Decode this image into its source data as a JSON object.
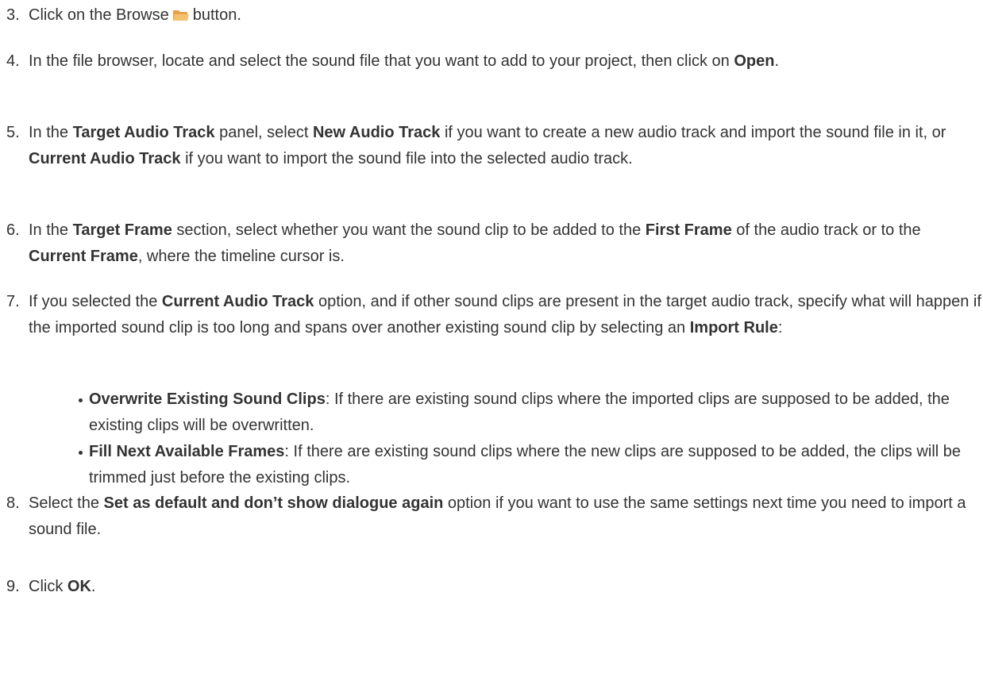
{
  "steps": [
    {
      "num": "3.",
      "parts": [
        {
          "t": "Click on the Browse"
        },
        {
          "icon": "folder-icon"
        },
        {
          "t": "button."
        }
      ]
    },
    {
      "num": "4.",
      "parts": [
        {
          "t": "In the file browser, locate and select the sound file that you want to add to your project, then click on "
        },
        {
          "b": "Open"
        },
        {
          "t": "."
        }
      ]
    },
    {
      "num": "5.",
      "parts": [
        {
          "t": "In the "
        },
        {
          "b": "Target Audio Track"
        },
        {
          "t": " panel, select "
        },
        {
          "b": "New Audio Track"
        },
        {
          "t": " if you want to create a new audio track and import the sound file in it, or "
        },
        {
          "b": "Current Audio Track"
        },
        {
          "t": " if you want to import the sound file into the selected audio track."
        }
      ]
    },
    {
      "num": "6.",
      "parts": [
        {
          "t": "In the "
        },
        {
          "b": "Target Frame"
        },
        {
          "t": " section, select whether you want the sound clip to be added to the "
        },
        {
          "b": "First Frame"
        },
        {
          "t": " of the audio track or to the "
        },
        {
          "b": "Current Frame"
        },
        {
          "t": ", where the timeline cursor is."
        }
      ]
    },
    {
      "num": "7.",
      "parts": [
        {
          "t": "If you selected the "
        },
        {
          "b": "Current Audio Track"
        },
        {
          "t": " option, and if other sound clips are present in the target audio track, specify what will happen if the imported sound clip is too long and spans over another existing sound clip by selecting an "
        },
        {
          "b": "Import Rule"
        },
        {
          "t": ":"
        }
      ],
      "bullets": [
        [
          {
            "b": "Overwrite Existing Sound Clips"
          },
          {
            "t": ": If there are existing sound clips where the imported clips are supposed to be added, the existing clips will be overwritten."
          }
        ],
        [
          {
            "b": "Fill Next Available Frames"
          },
          {
            "t": ": If there are existing sound clips where the new clips are supposed to be added, the clips will be trimmed just before the existing clips."
          }
        ]
      ]
    },
    {
      "num": "8.",
      "parts": [
        {
          "t": "Select the "
        },
        {
          "b": "Set as default and don’t show dialogue again"
        },
        {
          "t": " option if you want to use the same settings next time you need to import a sound file."
        }
      ]
    },
    {
      "num": "9.",
      "parts": [
        {
          "t": "Click "
        },
        {
          "b": "OK"
        },
        {
          "t": "."
        }
      ]
    }
  ]
}
